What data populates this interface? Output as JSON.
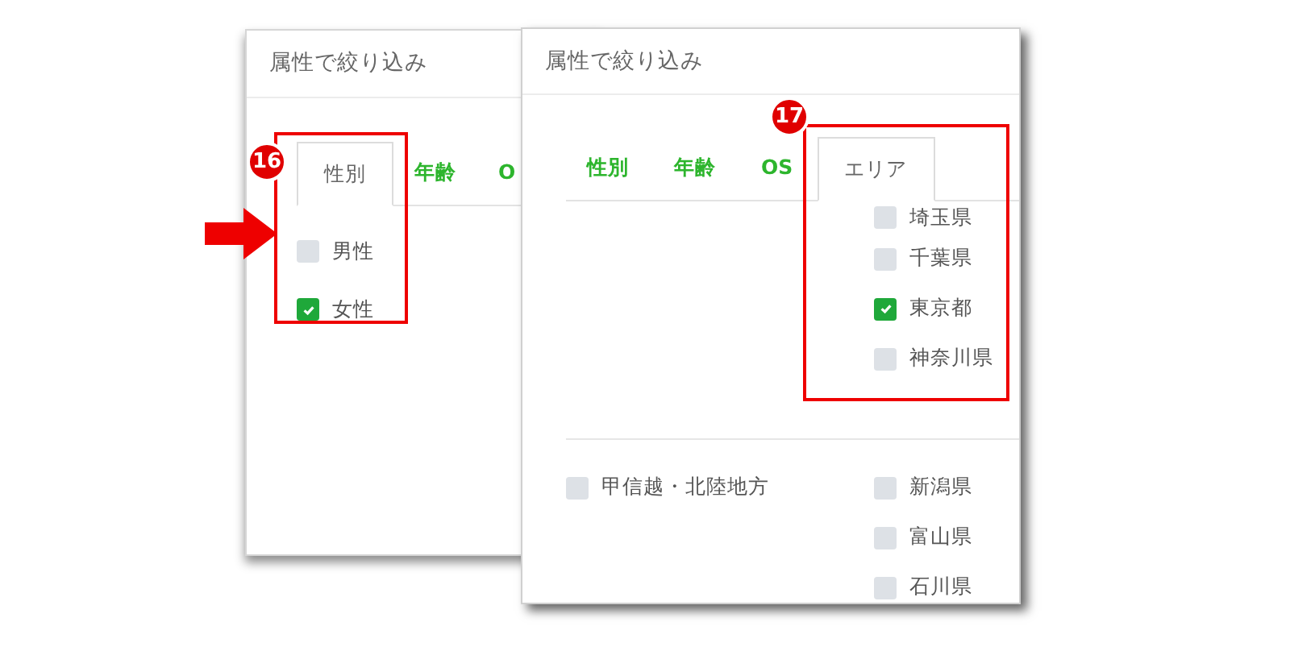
{
  "panels": [
    {
      "title": "属性で絞り込み",
      "callout": "16",
      "tabs": [
        {
          "label": "性別",
          "selected": true
        },
        {
          "label": "年齢",
          "selected": false
        },
        {
          "label": "O",
          "selected": false
        }
      ],
      "options": [
        {
          "label": "男性",
          "checked": false
        },
        {
          "label": "女性",
          "checked": true
        }
      ]
    },
    {
      "title": "属性で絞り込み",
      "callout": "17",
      "tabs": [
        {
          "label": "性別",
          "selected": false
        },
        {
          "label": "年齢",
          "selected": false
        },
        {
          "label": "OS",
          "selected": false
        },
        {
          "label": "エリア",
          "selected": true
        }
      ],
      "sections": [
        {
          "prefectures": [
            {
              "label": "埼玉県",
              "checked": false
            },
            {
              "label": "千葉県",
              "checked": false
            },
            {
              "label": "東京都",
              "checked": true
            },
            {
              "label": "神奈川県",
              "checked": false
            }
          ]
        },
        {
          "region": {
            "label": "甲信越・北陸地方",
            "checked": false
          },
          "prefectures": [
            {
              "label": "新潟県",
              "checked": false
            },
            {
              "label": "富山県",
              "checked": false
            },
            {
              "label": "石川県",
              "checked": false
            }
          ]
        }
      ]
    }
  ]
}
